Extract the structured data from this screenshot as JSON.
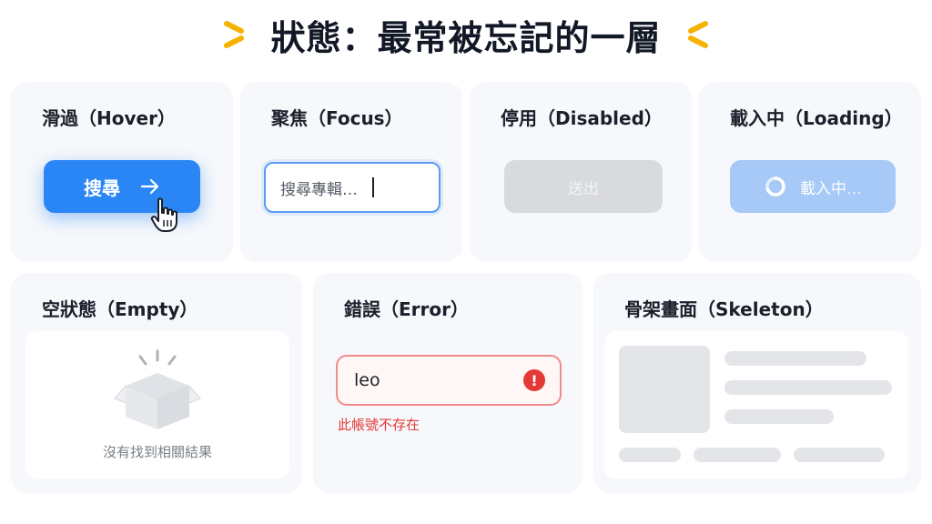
{
  "title": "狀態：最常被忘記的一層",
  "accent_color": "#f5b301",
  "cards": {
    "hover": {
      "label": "滑過（Hover）",
      "button_label": "搜尋",
      "button_icon": "arrow-right-icon",
      "cursor_icon": "hand-pointer-icon",
      "button_color": "#2b86f5"
    },
    "focus": {
      "label": "聚焦（Focus）",
      "placeholder": "搜尋專輯…",
      "border_color": "#5a9cf2"
    },
    "disabled": {
      "label": "停用（Disabled）",
      "button_label": "送出",
      "button_color": "#d8dadd"
    },
    "loading": {
      "label": "載入中（Loading）",
      "button_label": "載入中…",
      "spinner_icon": "spinner-icon",
      "button_color": "#a6c9f7"
    },
    "empty": {
      "label": "空狀態（Empty）",
      "message": "沒有找到相關結果",
      "illustration_icon": "empty-box-icon"
    },
    "error": {
      "label": "錯誤（Error）",
      "input_value": "leo",
      "error_message": "此帳號不存在",
      "error_icon": "exclamation-circle-icon",
      "error_color": "#e53935"
    },
    "skeleton": {
      "label": "骨架畫面（Skeleton）",
      "placeholder_color": "#e3e5e8"
    }
  }
}
